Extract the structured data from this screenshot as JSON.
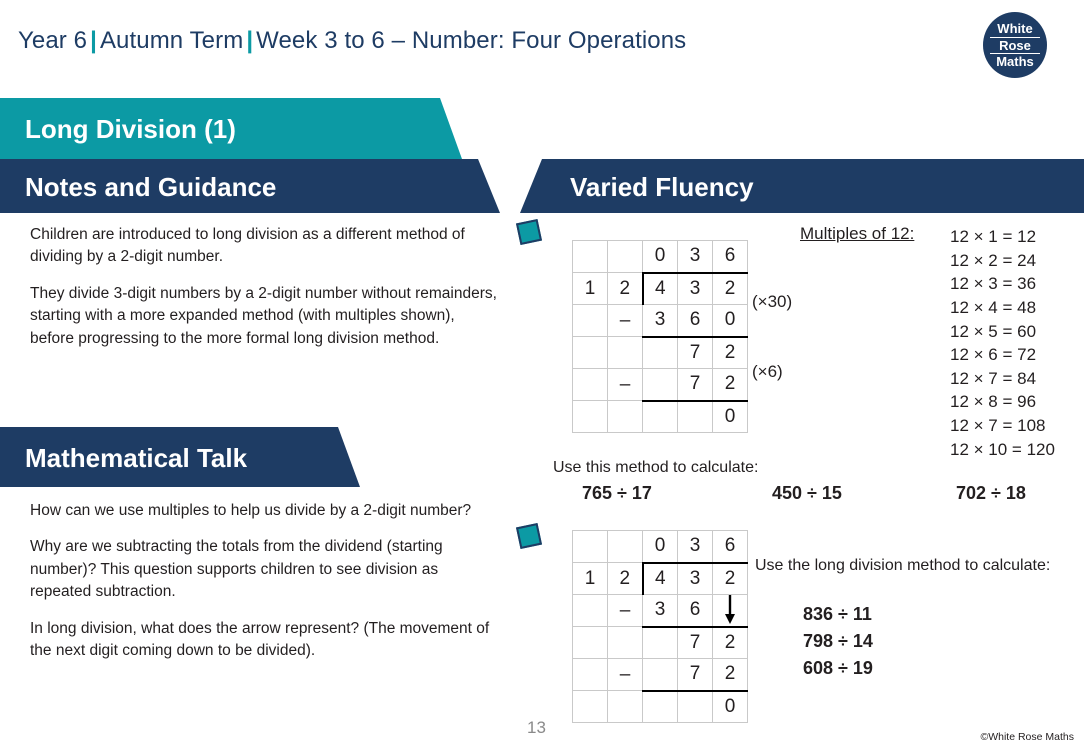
{
  "header": {
    "year": "Year 6",
    "term": "Autumn Term",
    "week": "Week 3 to 6 – Number: Four Operations",
    "separator": "|",
    "logo": {
      "line1": "White",
      "line2": "Rose",
      "line3": "Maths"
    }
  },
  "banners": {
    "lesson_title": "Long Division (1)",
    "notes_and_guidance": "Notes and Guidance",
    "varied_fluency": "Varied Fluency",
    "mathematical_talk": "Mathematical Talk"
  },
  "notes": {
    "paragraphs": [
      "Children are introduced to long division as a different method of dividing by a 2-digit number.",
      "They divide 3-digit numbers by a 2-digit number without remainders, starting with a more expanded method (with multiples shown), before progressing to the more formal long division method."
    ]
  },
  "talk": {
    "paragraphs": [
      "How can we use multiples to help us divide by a 2-digit number?",
      "Why are we subtracting the totals from the dividend (starting number)?  This question supports children to see division as repeated subtraction.",
      "In long division, what does the arrow represent?  (The movement of the next digit coming down to be divided)."
    ]
  },
  "grid_1": {
    "rows": [
      [
        "",
        "",
        "0",
        "3",
        "6"
      ],
      [
        "1",
        "2",
        "4",
        "3",
        "2"
      ],
      [
        "",
        "–",
        "3",
        "6",
        "0"
      ],
      [
        "",
        "",
        "",
        "7",
        "2"
      ],
      [
        "",
        "–",
        "",
        "7",
        "2"
      ],
      [
        "",
        "",
        "",
        "",
        "0"
      ]
    ],
    "annotations": {
      "first": "(×30)",
      "second": "(×6)"
    }
  },
  "grid_2": {
    "rows": [
      [
        "",
        "",
        "0",
        "3",
        "6"
      ],
      [
        "1",
        "2",
        "4",
        "3",
        "2"
      ],
      [
        "",
        "–",
        "3",
        "6",
        "arrow-down-icon"
      ],
      [
        "",
        "",
        "",
        "7",
        "2"
      ],
      [
        "",
        "–",
        "",
        "7",
        "2"
      ],
      [
        "",
        "",
        "",
        "",
        "0"
      ]
    ]
  },
  "multiples": {
    "heading": "Multiples of 12:",
    "items": [
      "12 × 1 = 12",
      "12 × 2 = 24",
      "12 × 3 = 36",
      "12 × 4 = 48",
      "12 × 5 = 60",
      "12 × 6 = 72",
      "12 × 7 = 84",
      "12 × 8 = 96",
      "12 × 7 = 108",
      "12 × 10 = 120"
    ]
  },
  "prompt_1": {
    "label": "Use this method to calculate:",
    "calculations": [
      "765 ÷ 17",
      "450 ÷ 15",
      "702 ÷ 18"
    ]
  },
  "prompt_2": {
    "label": "Use the long division method to calculate:",
    "calculations": [
      "836 ÷ 11",
      "798 ÷ 14",
      "608 ÷ 19"
    ]
  },
  "footer": {
    "page_number": "13",
    "copyright": "©White Rose Maths"
  },
  "colors": {
    "navy": "#1e3c64",
    "teal": "#0c9aa4",
    "text": "#231f20",
    "grid_line": "#c9c9c9",
    "grid_rule": "#000000",
    "page_number": "#8a8a8a"
  }
}
